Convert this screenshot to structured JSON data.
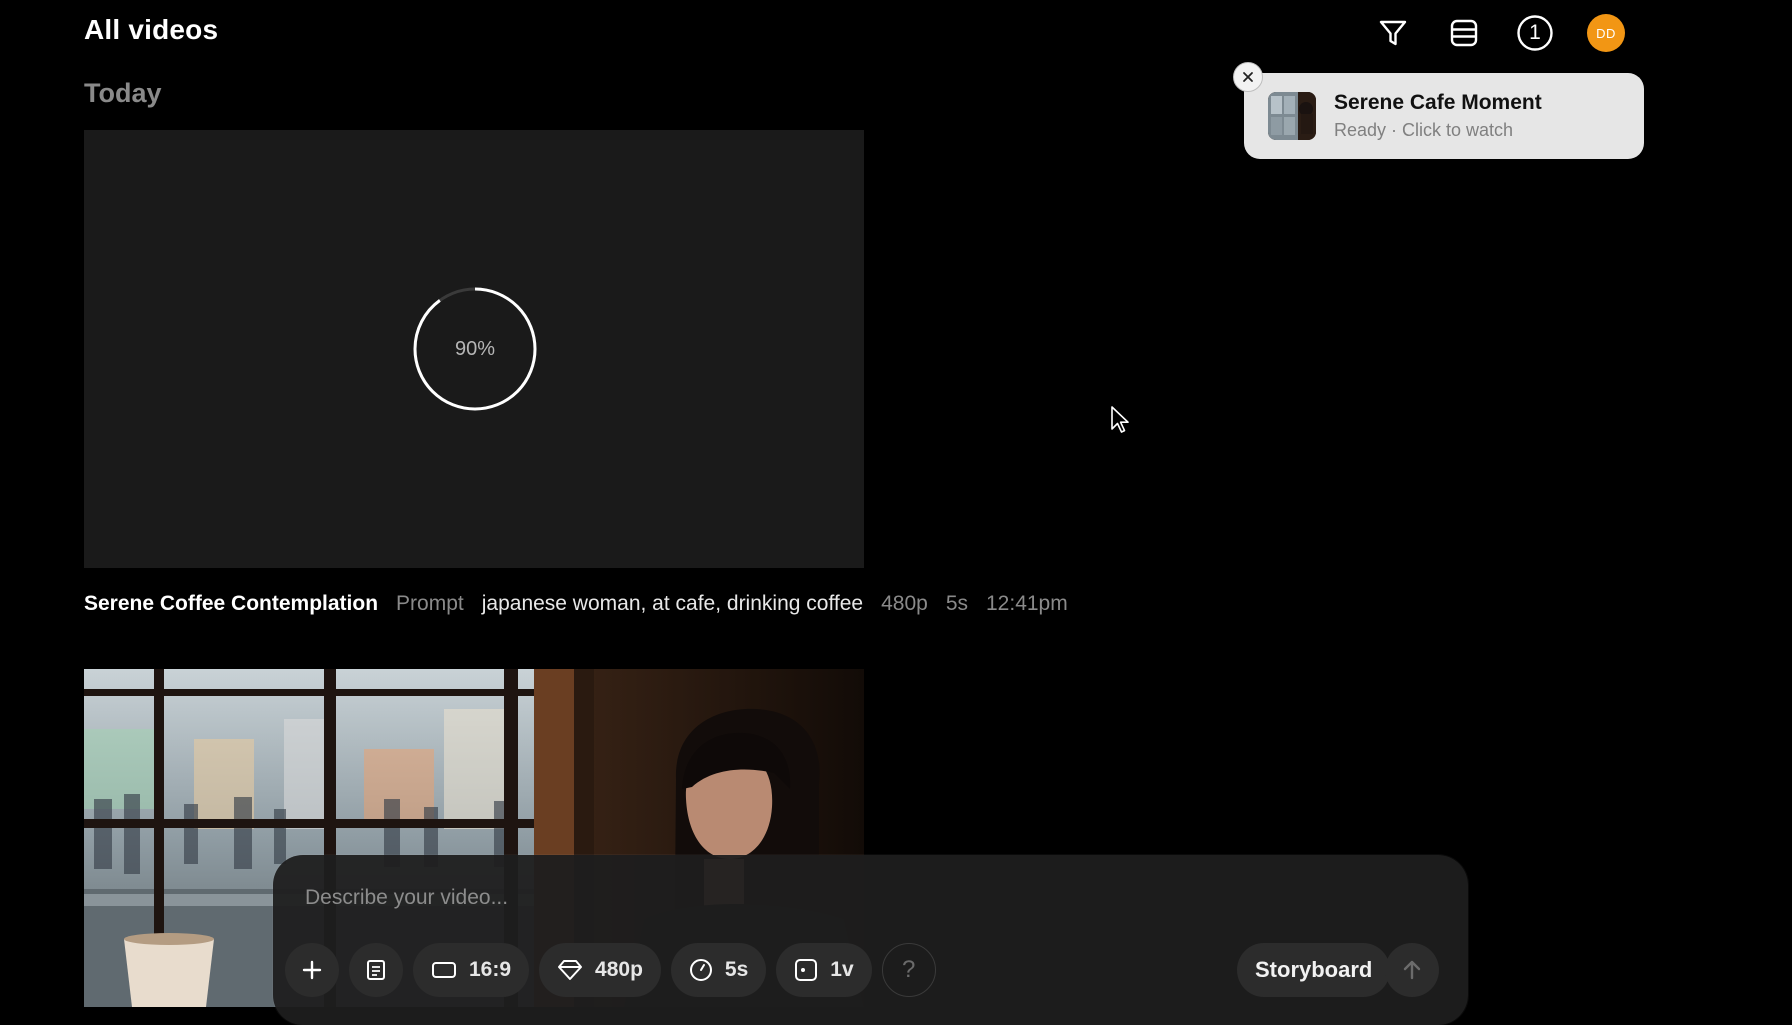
{
  "header": {
    "title": "All videos",
    "icons": [
      "filter-icon",
      "list-view-icon",
      "queue-count-icon",
      "avatar"
    ],
    "queue_count": "1",
    "avatar_initials": "DD",
    "avatar_color": "#f29614"
  },
  "section": {
    "label": "Today"
  },
  "notification": {
    "title": "Serene Cafe Moment",
    "subtitle": "Ready · Click to watch"
  },
  "videos": [
    {
      "status": "generating",
      "progress_label": "90%",
      "progress_fraction": 0.9,
      "title": "Serene Coffee Contemplation",
      "prompt_label": "Prompt",
      "prompt": "japanese woman, at cafe, drinking coffee",
      "resolution": "480p",
      "duration": "5s",
      "time": "12:41pm"
    },
    {
      "status": "ready",
      "thumbnail": "woman at cafe window"
    }
  ],
  "composer": {
    "placeholder": "Describe your video...",
    "aspect_ratio": "16:9",
    "resolution": "480p",
    "duration": "5s",
    "variations": "1v",
    "help": "?",
    "storyboard_label": "Storyboard"
  },
  "colors": {
    "background": "#000000",
    "card": "#1a1a1a",
    "toast": "#e6e6e6",
    "accent": "#f29614"
  }
}
